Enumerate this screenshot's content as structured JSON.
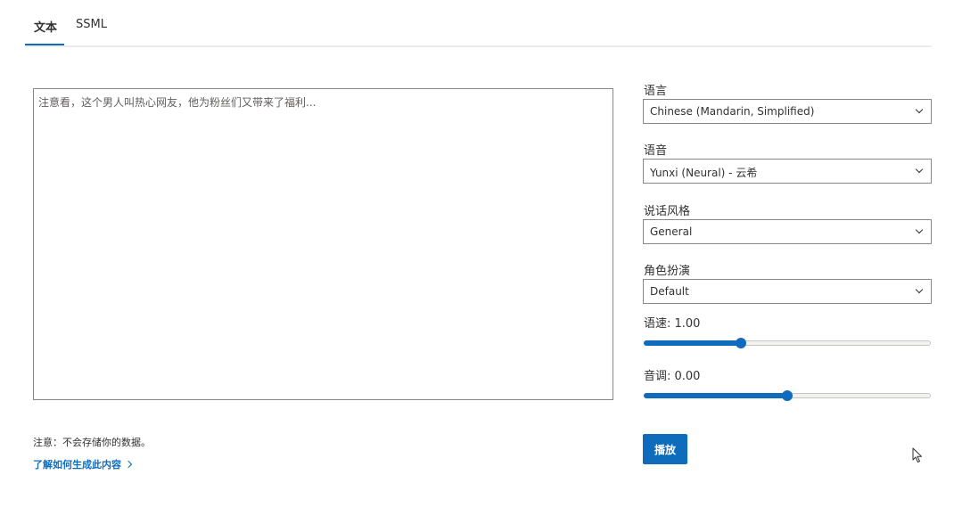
{
  "tabs": [
    {
      "label": "文本",
      "active": true
    },
    {
      "label": "SSML",
      "active": false
    }
  ],
  "editor": {
    "text": "注意看，这个男人叫热心网友，他为粉丝们又带来了福利..."
  },
  "footer": {
    "note": "注意：不会存储你的数据。",
    "learn_link": "了解如何生成此内容"
  },
  "settings": {
    "language": {
      "label": "语言",
      "value": "Chinese (Mandarin, Simplified)"
    },
    "voice": {
      "label": "语音",
      "value": "Yunxi (Neural) - 云希"
    },
    "style": {
      "label": "说话风格",
      "value": "General"
    },
    "role": {
      "label": "角色扮演",
      "value": "Default"
    },
    "rate": {
      "label": "语速: 1.00",
      "fraction": 0.34
    },
    "pitch": {
      "label": "音调: 0.00",
      "fraction": 0.5
    }
  },
  "play_label": "播放",
  "colors": {
    "accent": "#0f6cbd"
  }
}
